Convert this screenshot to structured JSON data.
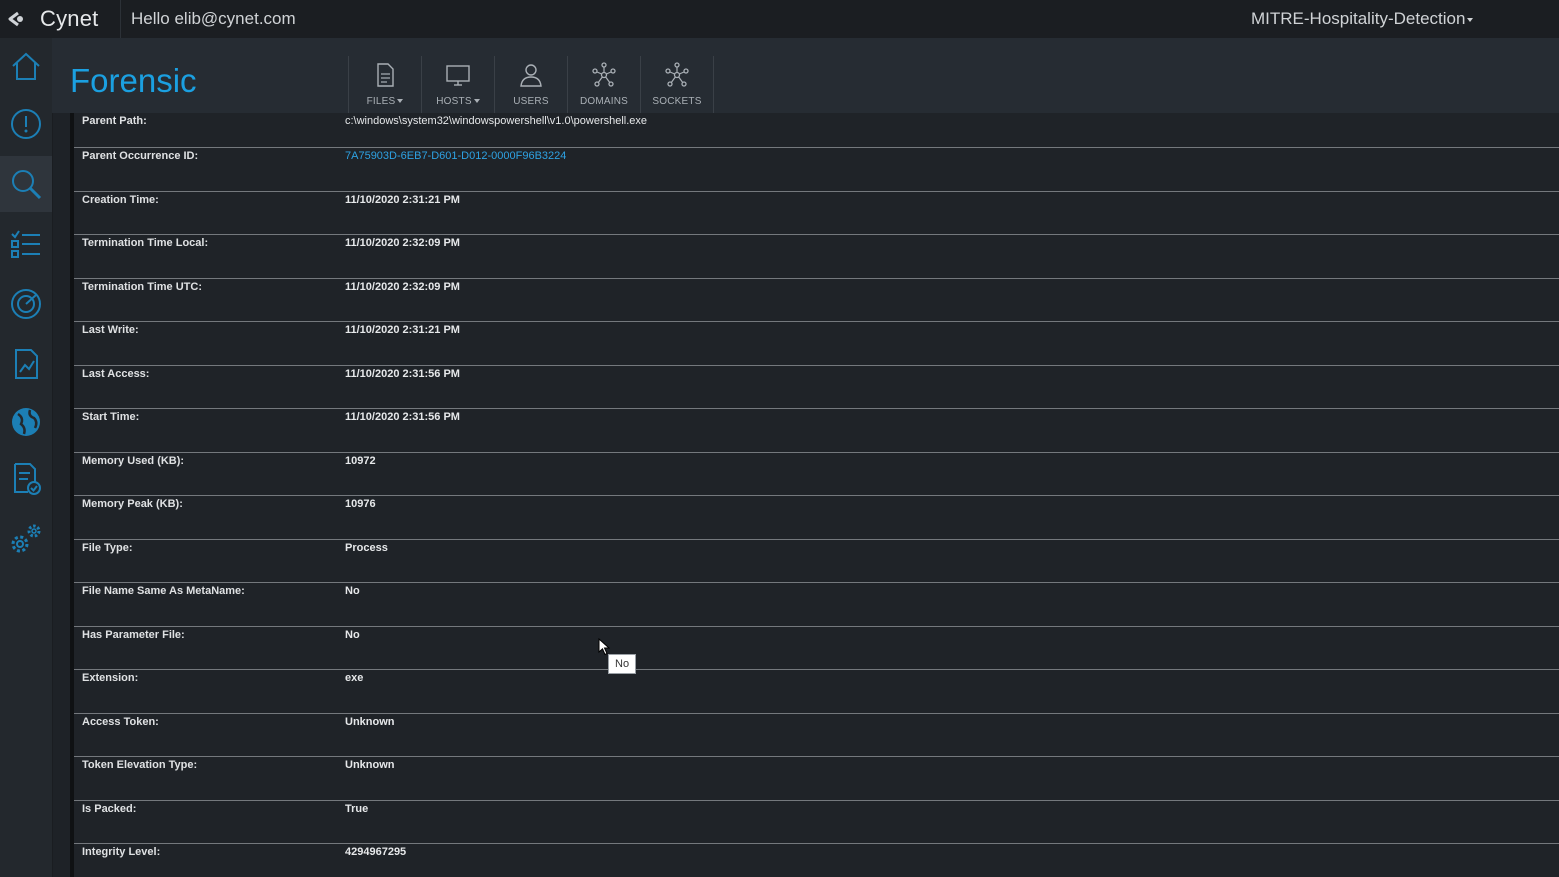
{
  "header": {
    "brand": "Cynet",
    "greeting": "Hello elib@cynet.com",
    "project": "MITRE-Hospitality-Detection"
  },
  "sidebar": {
    "items": [
      {
        "icon": "home-icon"
      },
      {
        "icon": "alert-icon"
      },
      {
        "icon": "search-icon",
        "active": true
      },
      {
        "icon": "list-icon"
      },
      {
        "icon": "radar-icon"
      },
      {
        "icon": "report-icon"
      },
      {
        "icon": "globe-icon"
      },
      {
        "icon": "checklist-icon"
      },
      {
        "icon": "settings-icon"
      }
    ]
  },
  "page": {
    "title": "Forensic",
    "toolbar": [
      {
        "label": "FILES",
        "icon": "file-icon",
        "dropdown": true
      },
      {
        "label": "HOSTS",
        "icon": "monitor-icon",
        "dropdown": true
      },
      {
        "label": "USERS",
        "icon": "user-icon",
        "dropdown": false
      },
      {
        "label": "DOMAINS",
        "icon": "network-icon",
        "dropdown": false
      },
      {
        "label": "SOCKETS",
        "icon": "network-icon",
        "dropdown": false
      }
    ]
  },
  "details": {
    "rows": [
      {
        "label": "Parent Path:",
        "value": "c:\\windows\\system32\\windowspowershell\\v1.0\\powershell.exe"
      },
      {
        "label": "Parent Occurrence ID:",
        "value": "7A75903D-6EB7-D601-D012-0000F96B3224"
      },
      {
        "label": "Creation Time:",
        "value": "11/10/2020 2:31:21 PM"
      },
      {
        "label": "Termination Time Local:",
        "value": "11/10/2020 2:32:09 PM"
      },
      {
        "label": "Termination Time UTC:",
        "value": "11/10/2020 2:32:09 PM"
      },
      {
        "label": "Last Write:",
        "value": "11/10/2020 2:31:21 PM"
      },
      {
        "label": "Last Access:",
        "value": "11/10/2020 2:31:56 PM"
      },
      {
        "label": "Start Time:",
        "value": "11/10/2020 2:31:56 PM"
      },
      {
        "label": "Memory Used (KB):",
        "value": "10972"
      },
      {
        "label": "Memory Peak (KB):",
        "value": "10976"
      },
      {
        "label": "File Type:",
        "value": "Process"
      },
      {
        "label": "File Name Same As MetaName:",
        "value": "No"
      },
      {
        "label": "Has Parameter File:",
        "value": "No"
      },
      {
        "label": "Extension:",
        "value": "exe"
      },
      {
        "label": "Access Token:",
        "value": "Unknown"
      },
      {
        "label": "Token Elevation Type:",
        "value": "Unknown"
      },
      {
        "label": "Is Packed:",
        "value": "True"
      },
      {
        "label": "Integrity Level:",
        "value": "4294967295"
      }
    ]
  },
  "tooltip": {
    "text": "No"
  },
  "colors": {
    "accent": "#1ba0e1",
    "link": "#2ea2e3",
    "background": "#1f2328"
  }
}
